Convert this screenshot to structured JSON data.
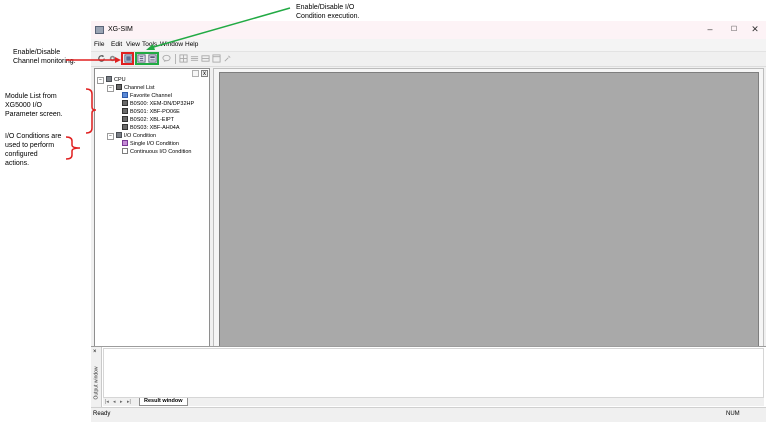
{
  "window": {
    "title": "XG-SIM",
    "minimize": "–",
    "maximize": "☐",
    "close": "✕"
  },
  "menu": [
    "File",
    "Edit",
    "View",
    "Tools",
    "Window",
    "Help"
  ],
  "tree": {
    "cpu": "CPU",
    "channel_list": "Channel List",
    "favorite_channel": "Favorite Channel",
    "modules": [
      "B0S00: XEM-DN/DP32HP",
      "B0S01: XBF-PO06E",
      "B0S02: XBL-EIPT",
      "B0S03: XBF-AH04A"
    ],
    "io_condition": "I/O Condition",
    "single_io": "Single I/O Condition",
    "continuous_io": "Continuous I/O Condition"
  },
  "output": {
    "side_label": "Output window",
    "close": "×",
    "nav": [
      "|◂",
      "◂",
      "▸",
      "▸|"
    ],
    "tab": "Result window"
  },
  "status": {
    "ready": "Ready",
    "num": "NUM"
  },
  "callouts": {
    "enable_io": "Enable/Disable I/O\nCondition execution.",
    "enable_channel": "Enable/Disable\nChannel monitoring.",
    "module_list": "Module List from\nXG5000 I/O\nParameter screen.",
    "io_conditions": "I/O Conditions are\nused to perform\nconfigured\nactions."
  },
  "colors": {
    "red": "#e02020",
    "green": "#22aa44",
    "canvas": "#a9a9a9"
  }
}
